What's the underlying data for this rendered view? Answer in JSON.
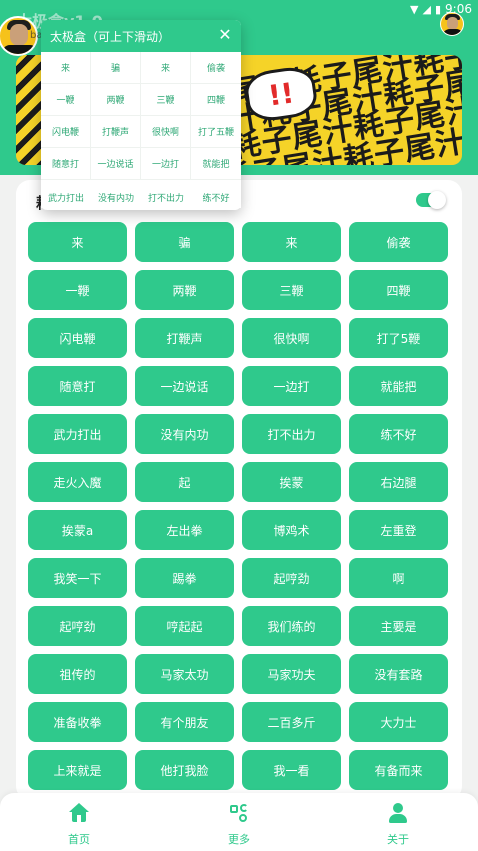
{
  "status_bar": {
    "app_title_faint": "太极盒v1.0",
    "time": "9:06",
    "wifi_icon": "wifi-icon",
    "signal_icon": "signal-icon",
    "battery_icon": "battery-icon"
  },
  "header": {
    "avatar_tag": "ba"
  },
  "banner": {
    "rows": [
      "耗子尾汁耗子尾汁耗子尾汁",
      "耗子尾汁耗子尾汁耗子尾汁",
      "耗子尾汁耗子尾汁耗子尾汁",
      "耗子尾汁耗子尾汁耗子尾汁"
    ],
    "burst_text": "!!"
  },
  "main": {
    "heading": "耗",
    "buttons": [
      "来",
      "骗",
      "来",
      "偷袭",
      "一鞭",
      "两鞭",
      "三鞭",
      "四鞭",
      "闪电鞭",
      "打鞭声",
      "很快啊",
      "打了5鞭",
      "随意打",
      "一边说话",
      "一边打",
      "就能把",
      "武力打出",
      "没有内功",
      "打不出力",
      "练不好",
      "走火入魔",
      "起",
      "挨蒙",
      "右边腿",
      "挨蒙a",
      "左出拳",
      "博鸡术",
      "左重登",
      "我笑一下",
      "踢拳",
      "起哼劲",
      "啊",
      "起哼劲",
      "哼起起",
      "我们练的",
      "主要是",
      "祖传的",
      "马家太功",
      "马家功夫",
      "没有套路",
      "准备收拳",
      "有个朋友",
      "二百多斤",
      "大力士",
      "上来就是",
      "他打我脸",
      "我一看",
      "有备而来"
    ]
  },
  "popup": {
    "title": "太极盒（可上下滑动）",
    "close_icon": "close-icon",
    "items": [
      "来",
      "骗",
      "来",
      "偷袭",
      "一鞭",
      "两鞭",
      "三鞭",
      "四鞭",
      "闪电鞭",
      "打鞭声",
      "很快啊",
      "打了五鞭",
      "随意打",
      "一边说话",
      "一边打",
      "就能把"
    ],
    "extra_items": [
      "武力打出",
      "没有内功",
      "打不出力",
      "练不好"
    ]
  },
  "bottom_nav": {
    "items": [
      {
        "label": "首页",
        "icon": "home-icon"
      },
      {
        "label": "更多",
        "icon": "more-icon"
      },
      {
        "label": "关于",
        "icon": "user-icon"
      }
    ]
  },
  "colors": {
    "accent": "#2fc98c",
    "banner_yellow": "#f5d328"
  }
}
